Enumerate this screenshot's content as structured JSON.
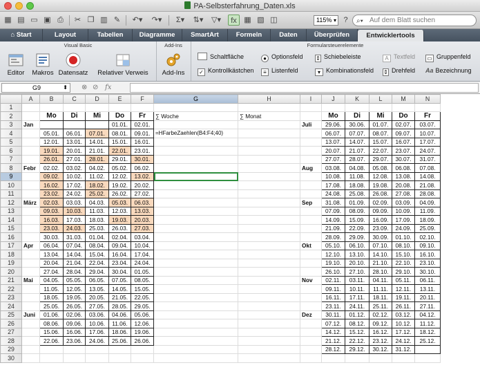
{
  "window": {
    "title": "PA-Selbsterfahrung_Daten.xls"
  },
  "toolbar": {
    "zoom": "115%",
    "search_placeholder": "Auf dem Blatt suchen"
  },
  "tabs": [
    "Start",
    "Layout",
    "Tabellen",
    "Diagramme",
    "SmartArt",
    "Formeln",
    "Daten",
    "Überprüfen",
    "Entwicklertools"
  ],
  "ribbon": {
    "group_vb": "Visual Basic",
    "group_addins": "Add-Ins",
    "group_controls": "Formularsteuerelemente",
    "editor": "Editor",
    "makros": "Makros",
    "datensatz": "Datensatz",
    "relativer_verweis": "Relativer Verweis",
    "addins_btn": "Add-Ins",
    "schaltflaeche": "Schaltfläche",
    "kontrollkaestchen": "Kontrollkästchen",
    "optionsfeld": "Optionsfeld",
    "listenfeld": "Listenfeld",
    "schiebeleiste": "Schiebeleiste",
    "kombinationsfeld": "Kombinationsfeld",
    "textfeld": "Textfeld",
    "drehfeld": "Drehfeld",
    "gruppenfeld": "Gruppenfeld",
    "bezeichnung": "Bezeichnung"
  },
  "formula_bar": {
    "cell": "G9",
    "fx": "fx",
    "content": ""
  },
  "columns": [
    "A",
    "B",
    "C",
    "D",
    "E",
    "F",
    "G",
    "H",
    "I",
    "J",
    "K",
    "L",
    "M",
    "N"
  ],
  "selected_col": "G",
  "selected_row": 9,
  "headers": {
    "week_sum": "∑ Woche",
    "month_sum": "∑ Monat",
    "days_left": [
      "Mo",
      "Di",
      "Mi",
      "Do",
      "Fr"
    ],
    "days_right": [
      "Mo",
      "Di",
      "Mi",
      "Do",
      "Fr"
    ]
  },
  "formula_text": "=HFarbeZaehlen(B4:F4;40)",
  "left_rows": [
    {
      "row": 3,
      "month": "Jan",
      "cells": [
        "",
        "",
        "",
        "01.01.",
        "02.01."
      ]
    },
    {
      "row": 4,
      "month": "",
      "cells": [
        "05.01.",
        "06.01.",
        "07.01.",
        "08.01.",
        "09.01."
      ]
    },
    {
      "row": 5,
      "month": "",
      "cells": [
        "12.01.",
        "13.01.",
        "14.01.",
        "15.01.",
        "16.01."
      ]
    },
    {
      "row": 6,
      "month": "",
      "cells": [
        "19.01.",
        "20.01.",
        "21.01.",
        "22.01.",
        "23.01."
      ]
    },
    {
      "row": 7,
      "month": "",
      "cells": [
        "26.01.",
        "27.01.",
        "28.01.",
        "29.01.",
        "30.01."
      ]
    },
    {
      "row": 8,
      "month": "Febr",
      "cells": [
        "02.02.",
        "03.02.",
        "04.02.",
        "05.02.",
        "06.02."
      ]
    },
    {
      "row": 9,
      "month": "",
      "cells": [
        "09.02.",
        "10.02.",
        "11.02.",
        "12.02.",
        "13.02."
      ]
    },
    {
      "row": 10,
      "month": "",
      "cells": [
        "16.02.",
        "17.02.",
        "18.02.",
        "19.02.",
        "20.02."
      ]
    },
    {
      "row": 11,
      "month": "",
      "cells": [
        "23.02.",
        "24.02.",
        "25.02.",
        "26.02.",
        "27.02."
      ]
    },
    {
      "row": 12,
      "month": "März",
      "cells": [
        "02.03.",
        "03.03.",
        "04.03.",
        "05.03.",
        "06.03."
      ]
    },
    {
      "row": 13,
      "month": "",
      "cells": [
        "09.03.",
        "10.03.",
        "11.03.",
        "12.03.",
        "13.03."
      ]
    },
    {
      "row": 14,
      "month": "",
      "cells": [
        "16.03.",
        "17.03.",
        "18.03.",
        "19.03.",
        "20.03."
      ]
    },
    {
      "row": 15,
      "month": "",
      "cells": [
        "23.03.",
        "24.03.",
        "25.03.",
        "26.03.",
        "27.03."
      ]
    },
    {
      "row": 16,
      "month": "",
      "cells": [
        "30.03.",
        "31.03.",
        "01.04.",
        "02.04.",
        "03.04."
      ]
    },
    {
      "row": 17,
      "month": "Apr",
      "cells": [
        "06.04.",
        "07.04.",
        "08.04.",
        "09.04.",
        "10.04."
      ]
    },
    {
      "row": 18,
      "month": "",
      "cells": [
        "13.04.",
        "14.04.",
        "15.04.",
        "16.04.",
        "17.04."
      ]
    },
    {
      "row": 19,
      "month": "",
      "cells": [
        "20.04.",
        "21.04.",
        "22.04.",
        "23.04.",
        "24.04."
      ]
    },
    {
      "row": 20,
      "month": "",
      "cells": [
        "27.04.",
        "28.04.",
        "29.04.",
        "30.04.",
        "01.05."
      ]
    },
    {
      "row": 21,
      "month": "Mai",
      "cells": [
        "04.05.",
        "05.05.",
        "06.05.",
        "07.05.",
        "08.05."
      ]
    },
    {
      "row": 22,
      "month": "",
      "cells": [
        "11.05.",
        "12.05.",
        "13.05.",
        "14.05.",
        "15.05."
      ]
    },
    {
      "row": 23,
      "month": "",
      "cells": [
        "18.05.",
        "19.05.",
        "20.05.",
        "21.05.",
        "22.05."
      ]
    },
    {
      "row": 24,
      "month": "",
      "cells": [
        "25.05.",
        "26.05.",
        "27.05.",
        "28.05.",
        "29.05."
      ]
    },
    {
      "row": 25,
      "month": "Juni",
      "cells": [
        "01.06.",
        "02.06.",
        "03.06.",
        "04.06.",
        "05.06."
      ]
    },
    {
      "row": 26,
      "month": "",
      "cells": [
        "08.06.",
        "09.06.",
        "10.06.",
        "11.06.",
        "12.06."
      ]
    },
    {
      "row": 27,
      "month": "",
      "cells": [
        "15.06.",
        "16.06.",
        "17.06.",
        "18.06.",
        "19.06."
      ]
    },
    {
      "row": 28,
      "month": "",
      "cells": [
        "22.06.",
        "23.06.",
        "24.06.",
        "25.06.",
        "26.06."
      ]
    }
  ],
  "highlighted": [
    [
      4,
      3
    ],
    [
      6,
      1
    ],
    [
      6,
      4
    ],
    [
      7,
      1
    ],
    [
      7,
      3
    ],
    [
      7,
      5
    ],
    [
      9,
      1
    ],
    [
      9,
      5
    ],
    [
      10,
      1
    ],
    [
      10,
      3
    ],
    [
      11,
      1
    ],
    [
      11,
      3
    ],
    [
      12,
      1
    ],
    [
      12,
      4
    ],
    [
      12,
      5
    ],
    [
      13,
      1
    ],
    [
      13,
      2
    ],
    [
      13,
      5
    ],
    [
      14,
      1
    ],
    [
      14,
      4
    ],
    [
      14,
      5
    ],
    [
      15,
      1
    ],
    [
      15,
      2
    ],
    [
      15,
      5
    ]
  ],
  "right_rows": [
    {
      "row": 3,
      "month": "Juli",
      "cells": [
        "29.06.",
        "30.06.",
        "01.07.",
        "02.07.",
        "03.07."
      ]
    },
    {
      "row": 4,
      "month": "",
      "cells": [
        "06.07.",
        "07.07.",
        "08.07.",
        "09.07.",
        "10.07."
      ]
    },
    {
      "row": 5,
      "month": "",
      "cells": [
        "13.07.",
        "14.07.",
        "15.07.",
        "16.07.",
        "17.07."
      ]
    },
    {
      "row": 6,
      "month": "",
      "cells": [
        "20.07.",
        "21.07.",
        "22.07.",
        "23.07.",
        "24.07."
      ]
    },
    {
      "row": 7,
      "month": "",
      "cells": [
        "27.07.",
        "28.07.",
        "29.07.",
        "30.07.",
        "31.07."
      ]
    },
    {
      "row": 8,
      "month": "Aug",
      "cells": [
        "03.08.",
        "04.08.",
        "05.08.",
        "06.08.",
        "07.08."
      ]
    },
    {
      "row": 9,
      "month": "",
      "cells": [
        "10.08.",
        "11.08.",
        "12.08.",
        "13.08.",
        "14.08."
      ]
    },
    {
      "row": 10,
      "month": "",
      "cells": [
        "17.08.",
        "18.08.",
        "19.08.",
        "20.08.",
        "21.08."
      ]
    },
    {
      "row": 11,
      "month": "",
      "cells": [
        "24.08.",
        "25.08.",
        "26.08.",
        "27.08.",
        "28.08."
      ]
    },
    {
      "row": 12,
      "month": "Sep",
      "cells": [
        "31.08.",
        "01.09.",
        "02.09.",
        "03.09.",
        "04.09."
      ]
    },
    {
      "row": 13,
      "month": "",
      "cells": [
        "07.09.",
        "08.09.",
        "09.09.",
        "10.09.",
        "11.09."
      ]
    },
    {
      "row": 14,
      "month": "",
      "cells": [
        "14.09.",
        "15.09.",
        "16.09.",
        "17.09.",
        "18.09."
      ]
    },
    {
      "row": 15,
      "month": "",
      "cells": [
        "21.09.",
        "22.09.",
        "23.09.",
        "24.09.",
        "25.09."
      ]
    },
    {
      "row": 16,
      "month": "",
      "cells": [
        "28.09.",
        "29.09.",
        "30.09.",
        "01.10.",
        "02.10."
      ]
    },
    {
      "row": 17,
      "month": "Okt",
      "cells": [
        "05.10.",
        "06.10.",
        "07.10.",
        "08.10.",
        "09.10."
      ]
    },
    {
      "row": 18,
      "month": "",
      "cells": [
        "12.10.",
        "13.10.",
        "14.10.",
        "15.10.",
        "16.10."
      ]
    },
    {
      "row": 19,
      "month": "",
      "cells": [
        "19.10.",
        "20.10.",
        "21.10.",
        "22.10.",
        "23.10."
      ]
    },
    {
      "row": 20,
      "month": "",
      "cells": [
        "26.10.",
        "27.10.",
        "28.10.",
        "29.10.",
        "30.10."
      ]
    },
    {
      "row": 21,
      "month": "Nov",
      "cells": [
        "02.11.",
        "03.11.",
        "04.11.",
        "05.11.",
        "06.11."
      ]
    },
    {
      "row": 22,
      "month": "",
      "cells": [
        "09.11.",
        "10.11.",
        "11.11.",
        "12.11.",
        "13.11."
      ]
    },
    {
      "row": 23,
      "month": "",
      "cells": [
        "16.11.",
        "17.11.",
        "18.11.",
        "19.11.",
        "20.11."
      ]
    },
    {
      "row": 24,
      "month": "",
      "cells": [
        "23.11.",
        "24.11.",
        "25.11.",
        "26.11.",
        "27.11."
      ]
    },
    {
      "row": 25,
      "month": "Dez",
      "cells": [
        "30.11.",
        "01.12.",
        "02.12.",
        "03.12.",
        "04.12."
      ]
    },
    {
      "row": 26,
      "month": "",
      "cells": [
        "07.12.",
        "08.12.",
        "09.12.",
        "10.12.",
        "11.12."
      ]
    },
    {
      "row": 27,
      "month": "",
      "cells": [
        "14.12.",
        "15.12.",
        "16.12.",
        "17.12.",
        "18.12."
      ]
    },
    {
      "row": 28,
      "month": "",
      "cells": [
        "21.12.",
        "22.12.",
        "23.12.",
        "24.12.",
        "25.12."
      ]
    },
    {
      "row": 29,
      "month": "",
      "cells": [
        "28.12.",
        "29.12.",
        "30.12.",
        "31.12.",
        ""
      ]
    }
  ],
  "colors": {
    "highlight": "#f9d9bd",
    "selection": "#2f8f3f",
    "tabbar": "#4f5b68"
  }
}
